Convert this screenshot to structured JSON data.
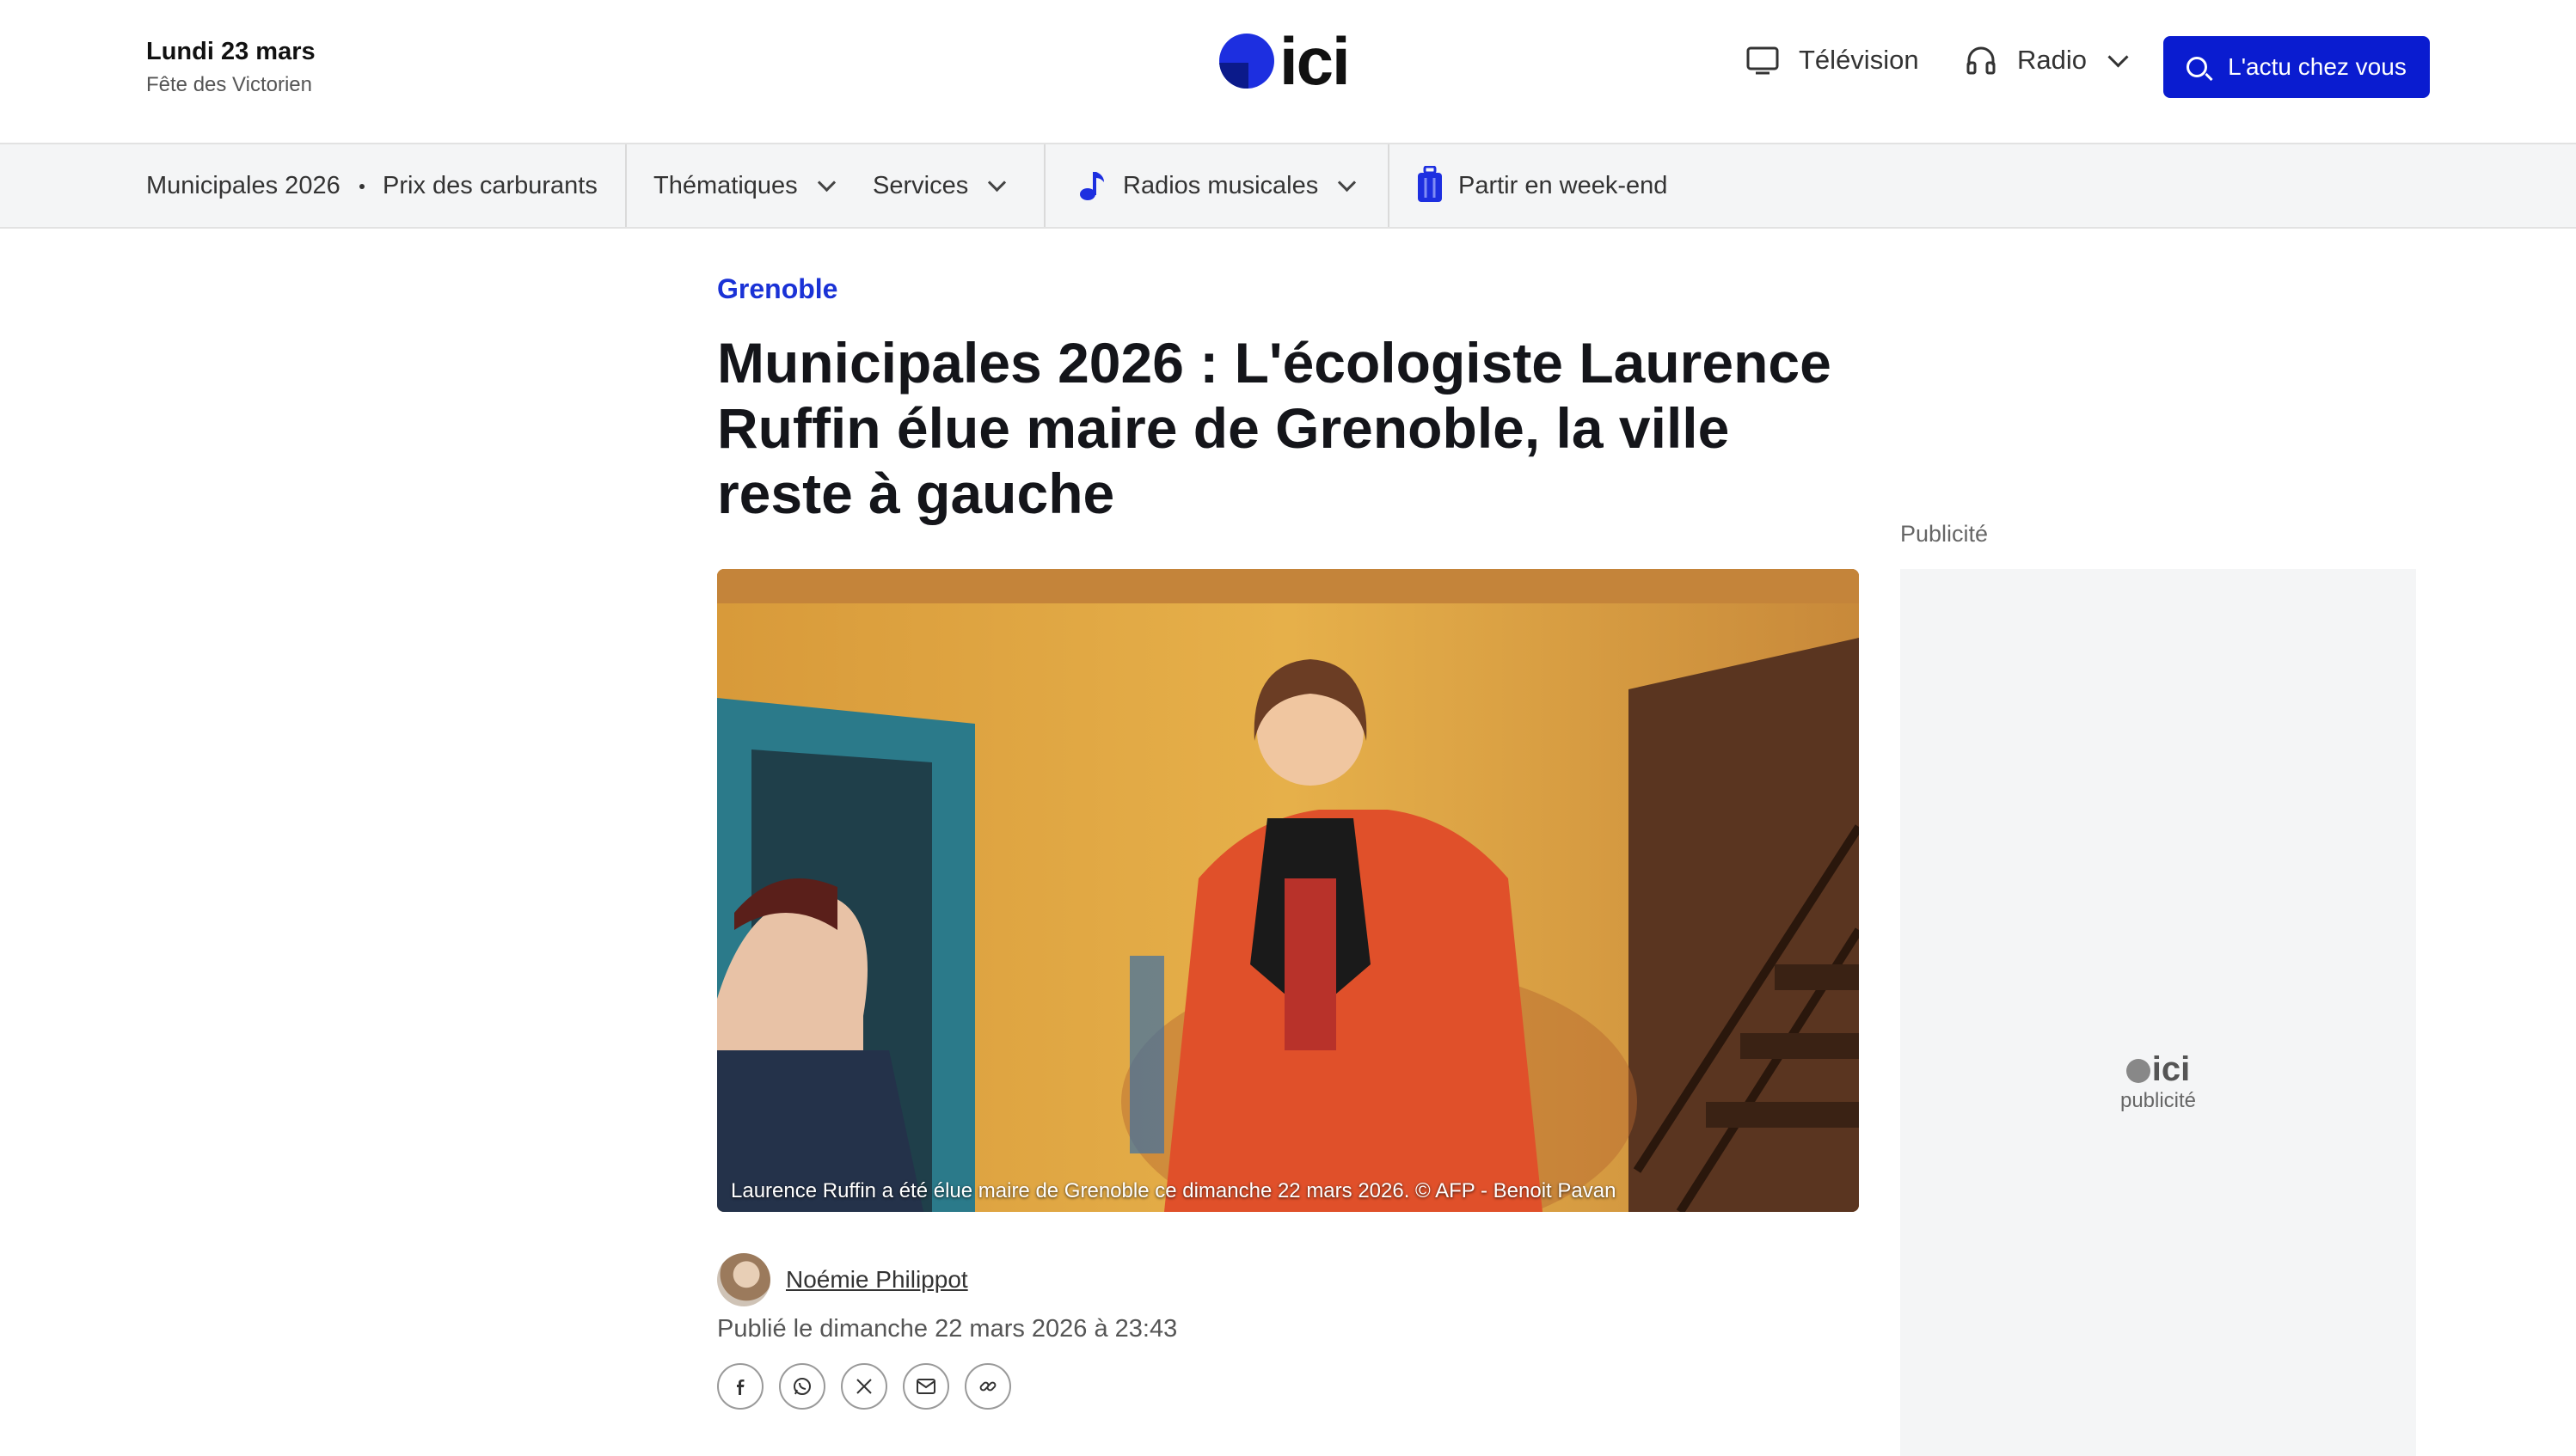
{
  "header": {
    "date": "Lundi 23 mars",
    "saint": "Fête des Victorien",
    "logo_text": "ici",
    "nav": {
      "television": "Télévision",
      "radio": "Radio",
      "cta": "L'actu chez vous"
    }
  },
  "subnav": {
    "items": [
      "Municipales 2026",
      "Prix des carburants",
      "Thématiques",
      "Services",
      "Radios musicales",
      "Partir en week-end"
    ]
  },
  "article": {
    "kicker": "Grenoble",
    "title": "Municipales 2026 : L'écologiste Laurence Ruffin élue maire de Grenoble, la ville reste à gauche",
    "image_caption": "Laurence Ruffin a été élue maire de Grenoble ce dimanche 22 mars 2026. © AFP - Benoit Pavan",
    "author": "Noémie Philippot",
    "published": "Publié le dimanche 22 mars 2026 à 23:43",
    "share_icons": [
      "facebook-icon",
      "whatsapp-icon",
      "x-icon",
      "email-icon",
      "link-icon"
    ]
  },
  "ad": {
    "label": "Publicité",
    "placeholder_logo": "ici",
    "placeholder_text": "publicité"
  },
  "colors": {
    "brand_blue": "#0a1cd0",
    "kicker_blue": "#1a32d6"
  }
}
